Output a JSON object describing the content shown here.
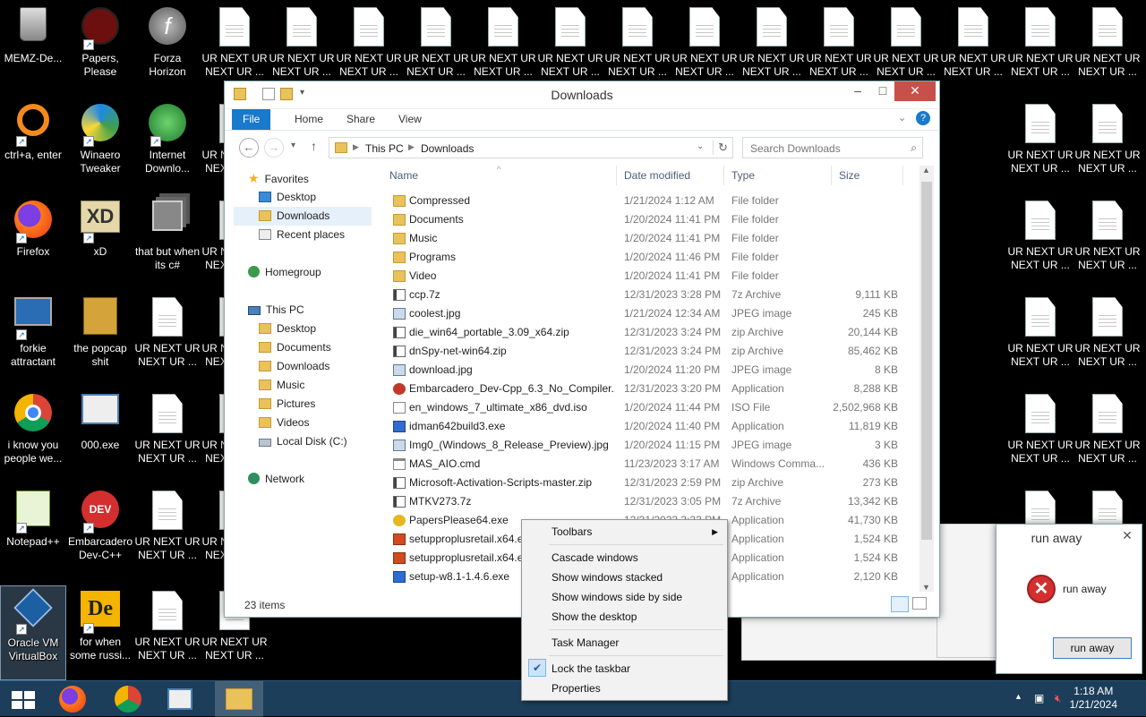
{
  "desktop": {
    "icons": [
      {
        "label": "MEMZ-De...",
        "icon": "recycle-bin-icon"
      },
      {
        "label": "Papers, Please",
        "icon": "papers-please-icon"
      },
      {
        "label": "Forza Horizon 5.exe",
        "icon": "flash-icon"
      },
      {
        "label": "ctrl+a, enter",
        "icon": "ring-icon"
      },
      {
        "label": "Winaero Tweaker",
        "icon": "winaero-icon"
      },
      {
        "label": "Internet Downlo...",
        "icon": "idm-icon"
      },
      {
        "label": "Firefox",
        "icon": "firefox-icon"
      },
      {
        "label": "xD",
        "icon": "xd-icon"
      },
      {
        "label": "that but when its c#",
        "icon": "stack-icon"
      },
      {
        "label": "forkie attractant",
        "icon": "gear-monitor-icon"
      },
      {
        "label": "the popcap shit",
        "icon": "popcap-icon"
      },
      {
        "label": "i know you people we...",
        "icon": "chrome-icon"
      },
      {
        "label": "000.exe",
        "icon": "window-icon"
      },
      {
        "label": "Notepad++",
        "icon": "notepadpp-icon"
      },
      {
        "label": "Embarcadero Dev-C++",
        "icon": "devcpp-icon"
      },
      {
        "label": "Oracle VM VirtualBox",
        "icon": "virtualbox-icon"
      },
      {
        "label": "for when some russi...",
        "icon": "de-icon"
      }
    ],
    "doc_label": "UR NEXT UR NEXT UR ...",
    "doc_label_clipped": "UR N NEX"
  },
  "explorer": {
    "title": "Downloads",
    "tabs": [
      "File",
      "Home",
      "Share",
      "View"
    ],
    "breadcrumb": [
      "This PC",
      "Downloads"
    ],
    "search_placeholder": "Search Downloads",
    "nav": {
      "favorites": "Favorites",
      "fav_items": [
        "Desktop",
        "Downloads",
        "Recent places"
      ],
      "homegroup": "Homegroup",
      "thispc": "This PC",
      "pc_items": [
        "Desktop",
        "Documents",
        "Downloads",
        "Music",
        "Pictures",
        "Videos",
        "Local Disk (C:)"
      ],
      "network": "Network"
    },
    "columns": [
      "Name",
      "Date modified",
      "Type",
      "Size"
    ],
    "files": [
      {
        "name": "Compressed",
        "date": "1/21/2024 1:12 AM",
        "type": "File folder",
        "size": "",
        "icon": "folder"
      },
      {
        "name": "Documents",
        "date": "1/20/2024 11:41 PM",
        "type": "File folder",
        "size": "",
        "icon": "folder"
      },
      {
        "name": "Music",
        "date": "1/20/2024 11:41 PM",
        "type": "File folder",
        "size": "",
        "icon": "folder"
      },
      {
        "name": "Programs",
        "date": "1/20/2024 11:46 PM",
        "type": "File folder",
        "size": "",
        "icon": "folder"
      },
      {
        "name": "Video",
        "date": "1/20/2024 11:41 PM",
        "type": "File folder",
        "size": "",
        "icon": "folder"
      },
      {
        "name": "ccp.7z",
        "date": "12/31/2023 3:28 PM",
        "type": "7z Archive",
        "size": "9,111 KB",
        "icon": "archive"
      },
      {
        "name": "coolest.jpg",
        "date": "1/21/2024 12:34 AM",
        "type": "JPEG image",
        "size": "245 KB",
        "icon": "image"
      },
      {
        "name": "die_win64_portable_3.09_x64.zip",
        "date": "12/31/2023 3:24 PM",
        "type": "zip Archive",
        "size": "20,144 KB",
        "icon": "archive"
      },
      {
        "name": "dnSpy-net-win64.zip",
        "date": "12/31/2023 3:24 PM",
        "type": "zip Archive",
        "size": "85,462 KB",
        "icon": "archive"
      },
      {
        "name": "download.jpg",
        "date": "1/20/2024 11:20 PM",
        "type": "JPEG image",
        "size": "8 KB",
        "icon": "image"
      },
      {
        "name": "Embarcadero_Dev-Cpp_6.3_No_Compiler...",
        "date": "12/31/2023 3:20 PM",
        "type": "Application",
        "size": "8,288 KB",
        "icon": "red"
      },
      {
        "name": "en_windows_7_ultimate_x86_dvd.iso",
        "date": "1/20/2024 11:44 PM",
        "type": "ISO File",
        "size": "2,502,968 KB",
        "icon": "iso"
      },
      {
        "name": "idman642build3.exe",
        "date": "1/20/2024 11:40 PM",
        "type": "Application",
        "size": "11,819 KB",
        "icon": "app"
      },
      {
        "name": "Img0_(Windows_8_Release_Preview).jpg",
        "date": "1/20/2024 11:15 PM",
        "type": "JPEG image",
        "size": "3 KB",
        "icon": "image"
      },
      {
        "name": "MAS_AIO.cmd",
        "date": "11/23/2023 3:17 AM",
        "type": "Windows Comma...",
        "size": "436 KB",
        "icon": "cmd"
      },
      {
        "name": "Microsoft-Activation-Scripts-master.zip",
        "date": "12/31/2023 2:59 PM",
        "type": "zip Archive",
        "size": "273 KB",
        "icon": "archive"
      },
      {
        "name": "MTKV273.7z",
        "date": "12/31/2023 3:05 PM",
        "type": "7z Archive",
        "size": "13,342 KB",
        "icon": "archive"
      },
      {
        "name": "PapersPlease64.exe",
        "date": "12/31/2023 3:33 PM",
        "type": "Application",
        "size": "41,730 KB",
        "icon": "yellow"
      },
      {
        "name": "setupproplusretail.x64.e",
        "date": "",
        "type": "Application",
        "size": "1,524 KB",
        "icon": "office"
      },
      {
        "name": "setupproplusretail.x64.e",
        "date": "",
        "type": "Application",
        "size": "1,524 KB",
        "icon": "office"
      },
      {
        "name": "setup-w8.1-1.4.6.exe",
        "date": "",
        "type": "Application",
        "size": "2,120 KB",
        "icon": "app"
      }
    ],
    "status": "23 items"
  },
  "context_menu": {
    "items": [
      "Toolbars",
      "Cascade windows",
      "Show windows stacked",
      "Show windows side by side",
      "Show the desktop",
      "Task Manager",
      "Lock the taskbar",
      "Properties"
    ]
  },
  "dialog": {
    "title": "run away",
    "message": "run away",
    "button": "run away"
  },
  "taskbar": {
    "time": "1:18 AM",
    "date": "1/21/2024"
  }
}
